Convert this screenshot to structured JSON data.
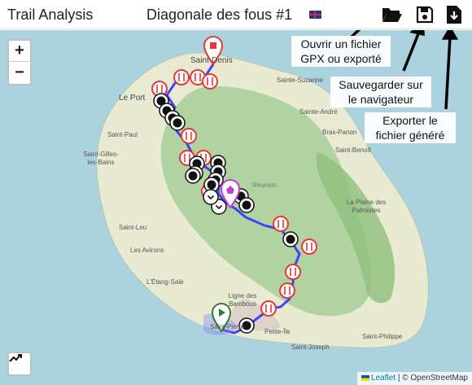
{
  "app": {
    "title": "Trail Analysis",
    "trace_title": "Diagonale des fous #1"
  },
  "toolbar": {
    "open_icon": "folder-open-icon",
    "save_icon": "floppy-disk-icon",
    "export_icon": "file-download-icon"
  },
  "callouts": {
    "open": [
      "Ouvrir un fichier",
      "GPX ou exporté"
    ],
    "save": [
      "Sauvegarder sur",
      "le navigateur"
    ],
    "export": [
      "Exporter le",
      "fichier généré"
    ]
  },
  "map": {
    "zoom_in": "+",
    "zoom_out": "−",
    "places": {
      "saint_denis": "Saint-Denis",
      "sainte_suzanne": "Sainte-Suzanne",
      "le_port": "Le Port",
      "sainte_andre": "Sainte-André",
      "saint_paul": "Saint-Paul",
      "bras_panon": "Bras-Panon",
      "saint_benoit": "Saint-Benoît",
      "saint_gilles": "Saint-Gilles-les-Bains",
      "reunion": "Réunion",
      "plaine_palmistes": "La Plaine des Palmistes",
      "saint_leu": "Saint-Leu",
      "les_avirons": "Les Avirons",
      "etang_sale": "L'Étang-Salé",
      "ligne_bambous": "Ligne des Bambous",
      "saint_pierre": "Saint-Pierre",
      "petite_ile": "Petite-Île",
      "saint_joseph": "Saint-Joseph",
      "saint_philippe": "Saint-Philippe"
    },
    "colors": {
      "sea": "#aad3df",
      "land": "#e8ead1",
      "forest": "#a7cf9a",
      "route": "#3333ff",
      "aid_station": "#e53935",
      "start": "#2e7d32",
      "finish": "#e53935",
      "poi": "#c040d0"
    },
    "chart_button_icon": "chart-line-icon"
  },
  "attribution": {
    "leaflet": "Leaflet",
    "separator": " | © ",
    "osm": "OpenStreetMap"
  }
}
